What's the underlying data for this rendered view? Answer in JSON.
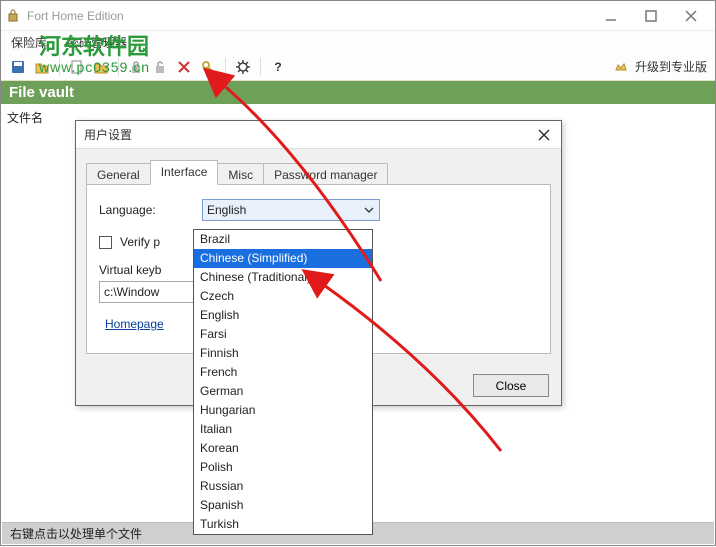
{
  "window": {
    "title": "Fort Home Edition"
  },
  "menubar": {
    "items": [
      "保险库",
      "密码管理器"
    ]
  },
  "watermark": {
    "top": "河东软件园",
    "bottom": "www.pc0359.cn"
  },
  "toolbar": {
    "upgrade_label": "升级到专业版"
  },
  "filevault": {
    "label": "File vault"
  },
  "sidebar": {
    "label": "文件名"
  },
  "statusbar": {
    "text": "右键点击以处理单个文件"
  },
  "dialog": {
    "title": "用户设置",
    "tabs": [
      {
        "label": "General"
      },
      {
        "label": "Interface"
      },
      {
        "label": "Misc"
      },
      {
        "label": "Password manager"
      }
    ],
    "language": {
      "label": "Language:",
      "value": "English",
      "options": [
        "Brazil",
        "Chinese (Simplified)",
        "Chinese (Traditional)",
        "Czech",
        "English",
        "Farsi",
        "Finnish",
        "French",
        "German",
        "Hungarian",
        "Italian",
        "Korean",
        "Polish",
        "Russian",
        "Spanish",
        "Turkish"
      ],
      "highlighted_index": 1
    },
    "verify": {
      "label": "Verify p"
    },
    "vk": {
      "label": "Virtual keyb",
      "value": "c:\\Window"
    },
    "browse_label": "...",
    "homepage_label": "Homepage",
    "close_label": "Close"
  },
  "colors": {
    "accent_green": "#6fa05a",
    "highlight_blue": "#1a6fe0",
    "arrow_red": "#e11b1b"
  }
}
